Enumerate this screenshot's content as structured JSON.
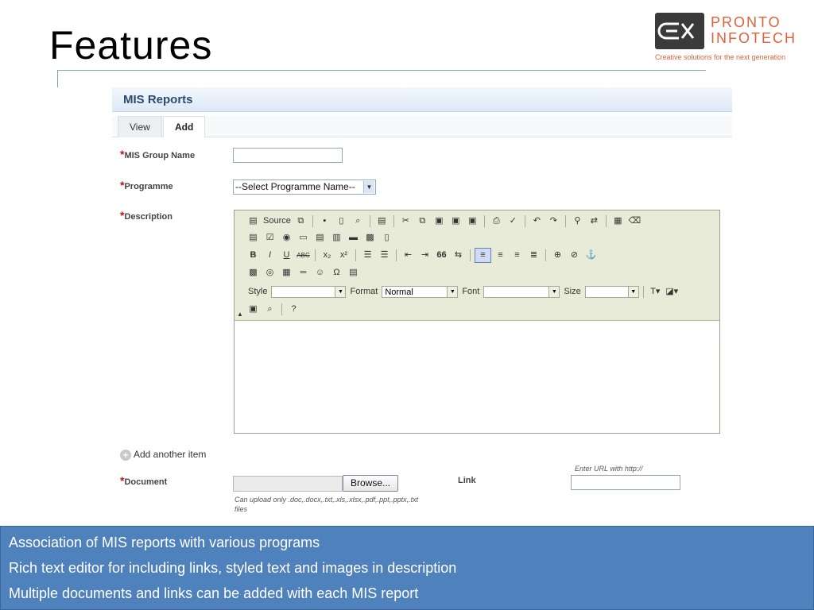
{
  "slide": {
    "title": "Features"
  },
  "logo": {
    "line1": "PRONTO",
    "line2": "INFOTECH",
    "tagline": "Creative solutions for the next generation"
  },
  "panel": {
    "title": "MIS Reports",
    "tabs": [
      {
        "label": "View",
        "active": false
      },
      {
        "label": "Add",
        "active": true
      }
    ],
    "required_marker": "*",
    "fields": {
      "group_name_label": "MIS Group Name",
      "group_name_value": "",
      "programme_label": "Programme",
      "programme_selected": "--Select Programme Name--",
      "description_label": "Description",
      "document_label": "Document",
      "link_label": "Link",
      "link_hint": "Enter URL with http://",
      "link_value": "",
      "upload_hint_line1": "Can upload only .doc,.docx,.txt,.xls,.xlsx,.pdf,.ppt,.pptx,.txt",
      "upload_hint_line2": "files",
      "browse_label": "Browse..."
    },
    "add_another": "Add another item",
    "add_icon": "plus-circle-icon"
  },
  "editor": {
    "source_label": "Source",
    "row3_icons": {
      "bold": "B",
      "italic": "I",
      "underline": "U",
      "strike": "ABC",
      "subscript": "x₂",
      "superscript": "x²",
      "blockquote": "66"
    },
    "style_label": "Style",
    "style_value": "",
    "format_label": "Format",
    "format_value": "Normal",
    "font_label": "Font",
    "font_value": "",
    "size_label": "Size",
    "size_value": "",
    "active_button": "align-left",
    "accent": "#6b7fb6",
    "toolbar_bg": "#e8ebd8"
  },
  "bullets": [
    "Association of MIS reports with various programs",
    "Rich text editor for including links, styled text and images in description",
    "Multiple documents and links can be added with each MIS report"
  ],
  "colors": {
    "band": "#4f81bd",
    "logo_orange": "#e0623a",
    "panel_title": "#2d4a6e",
    "required": "#c0141b"
  }
}
